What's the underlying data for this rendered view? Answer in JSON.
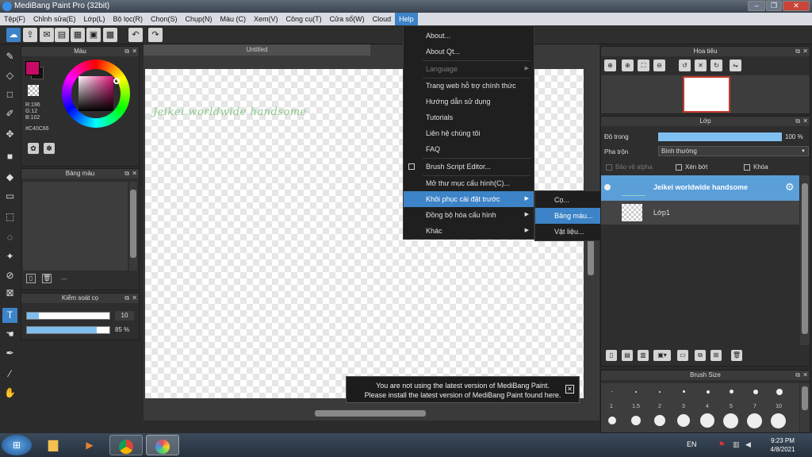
{
  "window": {
    "title": "MediBang Paint Pro (32bit)",
    "minimize": "‒",
    "maximize": "❐",
    "close": "✕"
  },
  "menubar": [
    "Tệp(F)",
    "Chỉnh sửa(E)",
    "Lớp(L)",
    "Bộ lọc(R)",
    "Chọn(S)",
    "Chụp(N)",
    "Màu (C)",
    "Xem(V)",
    "Công cụ(T)",
    "Cửa sổ(W)",
    "Cloud",
    "Help"
  ],
  "toolbar": {
    "icons": [
      "cloud-icon",
      "share-icon",
      "chat-icon",
      "comment-icon",
      "document-icon",
      "grid-icon",
      "layout-icon",
      "undo-icon",
      "redo-icon"
    ]
  },
  "color_panel": {
    "title": "Màu",
    "r": "R:196",
    "g": "G:12",
    "b": "B:102",
    "hex": "#C40C66",
    "primary_color": "#C40C66"
  },
  "palette_panel": {
    "title": "Bảng màu",
    "footer": "---"
  },
  "brush_control": {
    "title": "Kiểm soát cọ",
    "size_value": "10",
    "size_fill": 0.14,
    "opacity_value": "85 %",
    "opacity_fill": 0.85
  },
  "canvas": {
    "tab_title": "Untitled",
    "text": "Jeikei worldwide handsome"
  },
  "help_menu": {
    "items": [
      "About...",
      "About Qt...",
      "Language",
      "Trang web hỗ trợ chính thức",
      "Hướng dẫn sử dụng",
      "Tutorials",
      "Liên hệ chúng tôi",
      "FAQ",
      "Brush Script Editor...",
      "Mở thư mục cấu hình(C)...",
      "Khôi phục cài đặt trước",
      "Đồng bộ hóa cấu hình",
      "Khác"
    ],
    "highlighted": "Khôi phục cài đặt trước"
  },
  "submenu": {
    "items": [
      "Cọ...",
      "Bảng màu...",
      "Vật liệu..."
    ],
    "highlighted": "Bảng màu..."
  },
  "navigator": {
    "title": "Hoa tiêu"
  },
  "layer_panel": {
    "title": "Lớp",
    "opacity_label": "Độ trong",
    "opacity_value": "100 %",
    "opacity_fill": 1.0,
    "blend_label": "Pha trộn",
    "blend_value": "Bình thường",
    "protect_alpha": "Bảo vệ alpha",
    "clipping": "Xén bớt",
    "lock": "Khóa",
    "layers": [
      "Jeikei worldwide handsome",
      "Lớp1"
    ]
  },
  "brush_size": {
    "title": "Brush Size",
    "labels": [
      "1",
      "1.5",
      "2",
      "3",
      "4",
      "5",
      "7",
      "10"
    ]
  },
  "notice": {
    "line1": "You are not using the latest version of MediBang Paint.",
    "line2": "Please install the latest version of MediBang Paint found here.",
    "close": "✕"
  },
  "taskbar": {
    "language": "EN",
    "time": "9:23 PM",
    "date": "4/8/2021"
  }
}
